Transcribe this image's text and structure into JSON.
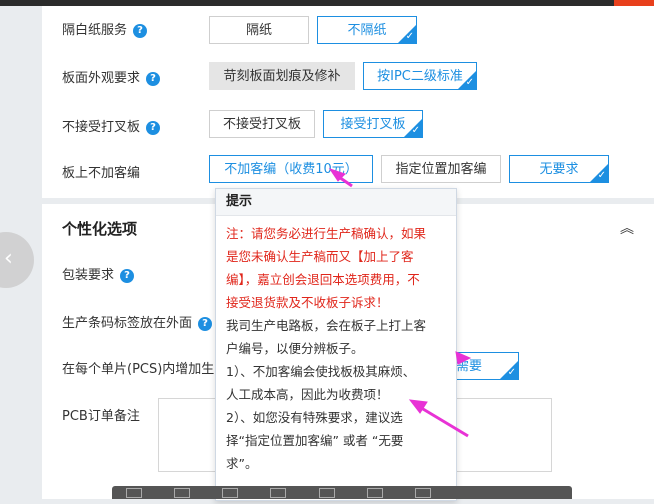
{
  "rows": [
    {
      "label": "隔白纸服务",
      "help": true,
      "options": [
        "隔纸",
        "不隔纸"
      ],
      "selected": 1
    },
    {
      "label": "板面外观要求",
      "help": true,
      "options": [
        "苛刻板面划痕及修补",
        "按IPC二级标准"
      ],
      "selected": 1
    },
    {
      "label": "不接受打叉板",
      "help": true,
      "options": [
        "不接受打叉板",
        "接受打叉板"
      ],
      "selected": 1
    },
    {
      "label": "板上不加客编",
      "help": false,
      "options": [
        "不加客编（收费10元）",
        "指定位置加客编",
        "无要求"
      ],
      "selected": 2
    }
  ],
  "section": {
    "title": "个性化选项",
    "collapse_icon": "double-chevron-up-icon"
  },
  "personal_rows": [
    {
      "label": "包装要求",
      "help": true
    },
    {
      "label": "生产条码标签放在外面",
      "help": true
    },
    {
      "label": "在每个单片(PCS)内增加生",
      "help": false,
      "option": "需要"
    },
    {
      "label": "PCB订单备注",
      "help": false
    }
  ],
  "tooltip": {
    "title": "提示",
    "red_lines": [
      "注：请您务必进行生产稿确认，如果",
      "是您未确认生产稿而又【加上了客",
      "编】，嘉立创会退回本选项费用，不",
      "接受退货款及不收板子诉求！"
    ],
    "lines": [
      "我司生产电路板，会在板子上打上客",
      "户编号，以便分辨板子。",
      "1）、不加客编会使找板极其麻烦、",
      "人工成本高，因此为收费项！",
      "2）、如您没有特殊要求，建议选",
      "择“指定位置加客编” 或者 “无要",
      "求”。"
    ]
  },
  "colors": {
    "accent": "#1d8fe1",
    "warning": "#e0261b",
    "annotation": "#e832d5"
  }
}
